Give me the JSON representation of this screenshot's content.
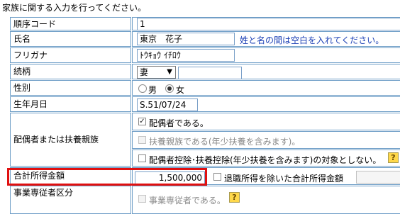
{
  "intro_text": "家族に関する入力を行ってください。",
  "rows": {
    "seq_code": {
      "label": "順序コード",
      "value": "1"
    },
    "name": {
      "label": "氏名",
      "value": "東京　花子",
      "note": "姓と名の間は空白を入れてください。"
    },
    "furigana": {
      "label": "フリガナ",
      "value": "ﾄｳｷｮｳ ｲﾁﾛｳ"
    },
    "relation": {
      "label": "続柄",
      "selected": "妻",
      "extra_value": ""
    },
    "gender": {
      "label": "性別",
      "options": [
        "男",
        "女"
      ],
      "selected": "女"
    },
    "birthdate": {
      "label": "生年月日",
      "value": "S.51/07/24"
    },
    "spouse": {
      "label": "配偶者または扶養親族",
      "opt_spouse": "配偶者である。",
      "opt_dependent": "扶養親族である(年少扶養を含みます)。",
      "opt_exclude": "配偶者控除･扶養控除(年少扶養を含みます)の対象としない。"
    },
    "income": {
      "label": "合計所得金額",
      "value": "1,500,000",
      "opt_retire": "退職所得を除いた合計所得金額",
      "retire_value": ""
    },
    "business": {
      "label_top": "事業専従者区分",
      "opt_business": "事業専従者である。"
    }
  },
  "help_glyph": "?",
  "colors": {
    "cell_border": "#6f9ec7",
    "highlight": "#e01010",
    "note": "#1a3fb5"
  }
}
